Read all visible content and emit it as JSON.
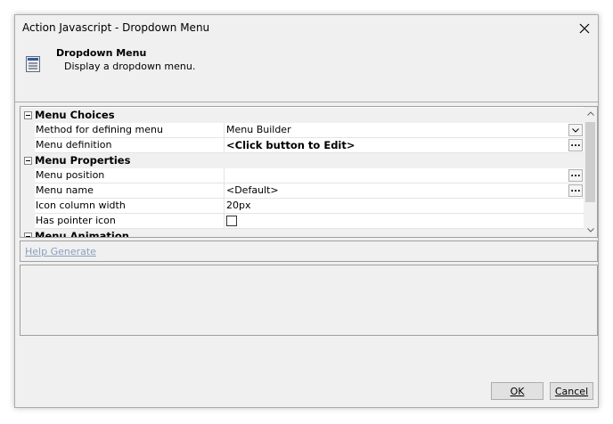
{
  "window": {
    "title": "Action Javascript - Dropdown Menu"
  },
  "header": {
    "title": "Dropdown Menu",
    "description": "Display a dropdown menu."
  },
  "grid": {
    "categories": [
      {
        "label": "Menu Choices",
        "properties": [
          {
            "name": "Method for defining menu",
            "value": "Menu Builder"
          },
          {
            "name": "Menu definition",
            "value": "<Click button to Edit>"
          }
        ]
      },
      {
        "label": "Menu Properties",
        "properties": [
          {
            "name": "Menu position",
            "value": ""
          },
          {
            "name": "Menu name",
            "value": "<Default>"
          },
          {
            "name": "Icon column width",
            "value": "20px"
          },
          {
            "name": "Has pointer icon",
            "value": ""
          }
        ]
      },
      {
        "label": "Menu Animation"
      }
    ],
    "ellipsis": "..."
  },
  "help": {
    "link": "Help Generate"
  },
  "buttons": {
    "ok": "OK",
    "cancel": "Cancel"
  }
}
